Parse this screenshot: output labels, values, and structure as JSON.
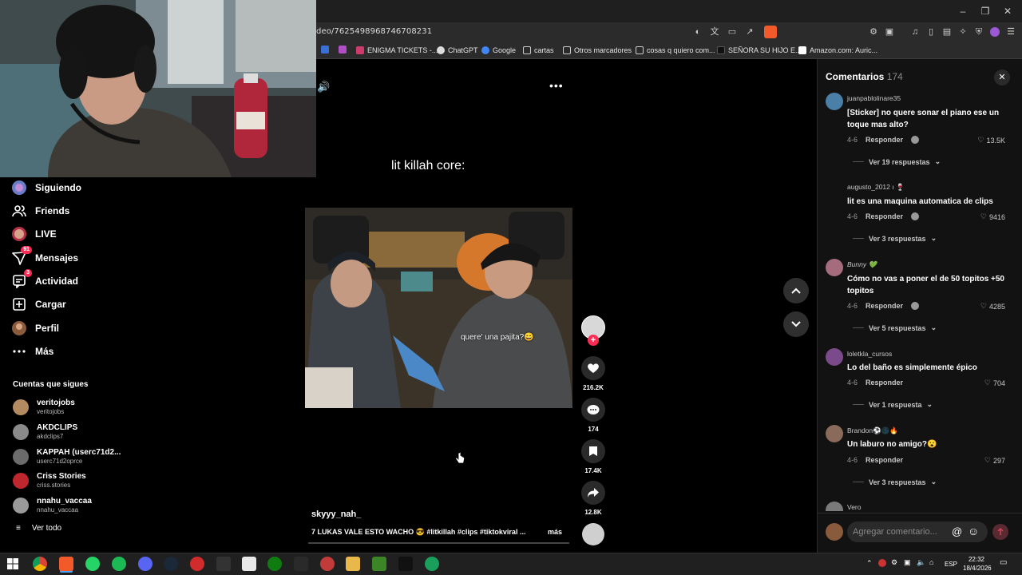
{
  "browser": {
    "url": "deo/7625498968746708231",
    "bookmarks": [
      {
        "label": "ENIGMA TICKETS -...",
        "color": "#cc3b6a"
      },
      {
        "label": "ChatGPT",
        "color": "#dcdcdc"
      },
      {
        "label": "Google",
        "color": "#4285f4"
      },
      {
        "label": "cartas",
        "color": "folder"
      },
      {
        "label": "Otros marcadores",
        "color": "folder"
      },
      {
        "label": "cosas q quiero com...",
        "color": "folder"
      },
      {
        "label": "SEÑORA SU HIJO E...",
        "color": "#111111"
      },
      {
        "label": "Amazon.com: Auric...",
        "color": "#222222"
      }
    ]
  },
  "sidebar": {
    "nav": [
      {
        "label": "Siguiendo",
        "icon": "following-icon"
      },
      {
        "label": "Friends",
        "icon": "friends-icon"
      },
      {
        "label": "LIVE",
        "icon": "live-icon"
      },
      {
        "label": "Mensajes",
        "icon": "messages-icon",
        "badge": "91"
      },
      {
        "label": "Actividad",
        "icon": "activity-icon",
        "badge": "3"
      },
      {
        "label": "Cargar",
        "icon": "upload-icon"
      },
      {
        "label": "Perfil",
        "icon": "profile-icon"
      },
      {
        "label": "Más",
        "icon": "more-icon"
      }
    ],
    "following_title": "Cuentas que sigues",
    "accounts": [
      {
        "name": "veritojobs",
        "handle": "veritojobs",
        "color": "#b48a60"
      },
      {
        "name": "AKDCLIPS",
        "handle": "akdclips7",
        "color": "#8a8a8a"
      },
      {
        "name": "KAPPAH (userc71d2...",
        "handle": "userc71d2oprce",
        "color": "#6b6b6b"
      },
      {
        "name": "Criss Stories",
        "handle": "criss.stories",
        "color": "#c0262d"
      },
      {
        "name": "nnahu_vaccaa",
        "handle": "nnahu_vaccaa",
        "color": "#9a9a9a"
      }
    ],
    "see_all": "Ver todo"
  },
  "video": {
    "caption_top": "lit killah core:",
    "subtitle": "quere' una pajita?😄",
    "author": "skyyy_nah_",
    "description": "7 LUKAS VALE ESTO WACHO 😎 #litkillah #clips #tiktokviral ...",
    "more": "más",
    "likes": "216.2K",
    "comments": "174",
    "saves": "17.4K",
    "shares": "12.8K"
  },
  "comments": {
    "title": "Comentarios",
    "count": "174",
    "input_placeholder": "Agregar comentario...",
    "reply_label": "Responder",
    "items": [
      {
        "user": "juanpablolinare35",
        "text": "[Sticker] no quere sonar el piano ese un toque mas alto?",
        "date": "4-6",
        "likes": "13.5K",
        "replies": "Ver 19 respuestas",
        "creator_liked": true,
        "color": "#4a7fa8"
      },
      {
        "user": "augusto_2012 ı 🍷",
        "text": "lit es una maquina automatica de clips",
        "date": "4-6",
        "likes": "9416",
        "replies": "Ver 3 respuestas",
        "creator_liked": true,
        "color": ""
      },
      {
        "user": "Bunny 💚",
        "text": "Cómo no vas a poner el de 50 topitos +50 topitos",
        "date": "4-6",
        "likes": "4285",
        "replies": "Ver 5 respuestas",
        "creator_liked": true,
        "color": "#a46c7c"
      },
      {
        "user": "loletkla_cursos",
        "text": "Lo del baño es simplemente épico",
        "date": "4-6",
        "likes": "704",
        "replies": "Ver 1 respuesta",
        "creator_liked": false,
        "color": "#7a4a8a"
      },
      {
        "user": "Brandon⚽🌑🔥",
        "text": "Un laburo no amigo?😮",
        "date": "4-6",
        "likes": "297",
        "replies": "Ver 3 respuestas",
        "creator_liked": false,
        "color": "#8a6a5a"
      },
      {
        "user": "Vero",
        "text": "",
        "date": "",
        "likes": "",
        "replies": "",
        "creator_liked": false,
        "color": "#7a7a7a"
      }
    ]
  },
  "taskbar": {
    "time": "22:32",
    "date": "18/4/2026",
    "lang": "ESP"
  }
}
